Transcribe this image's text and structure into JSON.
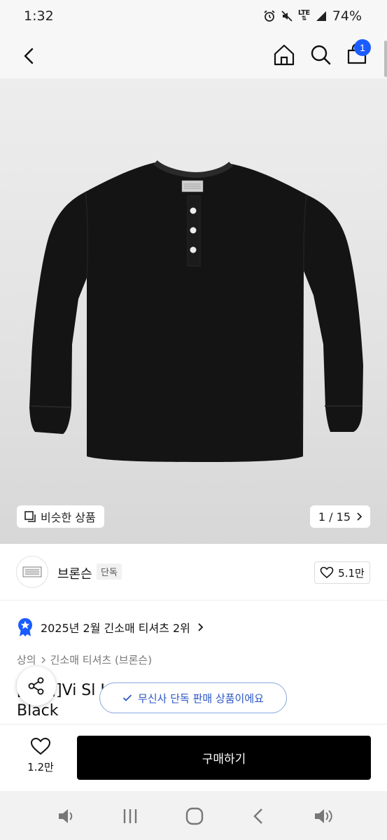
{
  "status_bar": {
    "time": "1:32",
    "network": "LTE",
    "battery": "74%",
    "icons": [
      "alarm-icon",
      "mute-icon",
      "lte-icon",
      "signal-icon"
    ]
  },
  "header": {
    "icons": [
      "back-icon",
      "home-icon",
      "search-icon",
      "cart-icon"
    ],
    "cart_count": "1"
  },
  "gallery": {
    "similar_label": "비슷한 상품",
    "page_current": "1",
    "page_total": "15",
    "page_text": "1 / 15"
  },
  "brand": {
    "name": "브론슨",
    "tag": "단독",
    "likes": "5.1만"
  },
  "ranking": {
    "text": "2025년 2월 긴소매 티셔츠 2위"
  },
  "breadcrumb": {
    "items": [
      "상의",
      "긴소매 티셔츠 (브론슨)"
    ]
  },
  "product": {
    "title_line1": "[    혜택]Vi                  Sl         Henley Shirt",
    "title_line2": "Black"
  },
  "toast": {
    "text": "무신사 단독 판매 상품이에요"
  },
  "bottom": {
    "wish_count": "1.2만",
    "buy_label": "구매하기"
  },
  "colors": {
    "accent": "#1a5cff",
    "toast_text": "#2b55c4",
    "buy_button": "#000000"
  }
}
